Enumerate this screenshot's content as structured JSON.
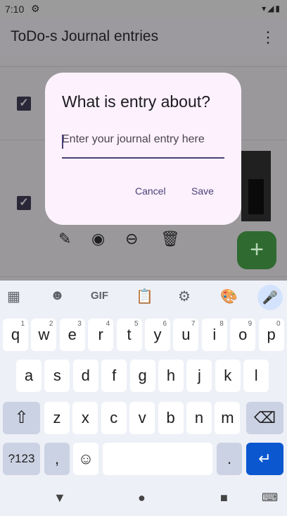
{
  "status_bar": {
    "time": "7:10",
    "icons_right": "▾◢▮"
  },
  "app_bar": {
    "title": "ToDo-s Journal entries",
    "menu_icon": "⋮"
  },
  "list": {
    "checkbox_mark": "✓",
    "fab_label": "+"
  },
  "dialog": {
    "title": "What is entry about?",
    "placeholder": "Enter your journal entry here",
    "cancel": "Cancel",
    "save": "Save"
  },
  "keyboard": {
    "gif_label": "GIF",
    "row1": [
      {
        "k": "q",
        "h": "1"
      },
      {
        "k": "w",
        "h": "2"
      },
      {
        "k": "e",
        "h": "3"
      },
      {
        "k": "r",
        "h": "4"
      },
      {
        "k": "t",
        "h": "5"
      },
      {
        "k": "y",
        "h": "6"
      },
      {
        "k": "u",
        "h": "7"
      },
      {
        "k": "i",
        "h": "8"
      },
      {
        "k": "o",
        "h": "9"
      },
      {
        "k": "p",
        "h": "0"
      }
    ],
    "row2": [
      "a",
      "s",
      "d",
      "f",
      "g",
      "h",
      "j",
      "k",
      "l"
    ],
    "row3": [
      "z",
      "x",
      "c",
      "v",
      "b",
      "n",
      "m"
    ],
    "symbols": "?123",
    "comma": ",",
    "period": ".",
    "emoji": "☺",
    "shift": "⇧",
    "backspace": "⌫",
    "enter": "↵"
  },
  "nav": {
    "back": "▼",
    "home": "●",
    "recents": "■",
    "keyboard": "⌨"
  },
  "colors": {
    "accent": "#4a3f78",
    "fab": "#2f6a30",
    "enter_key": "#0b57d0"
  }
}
